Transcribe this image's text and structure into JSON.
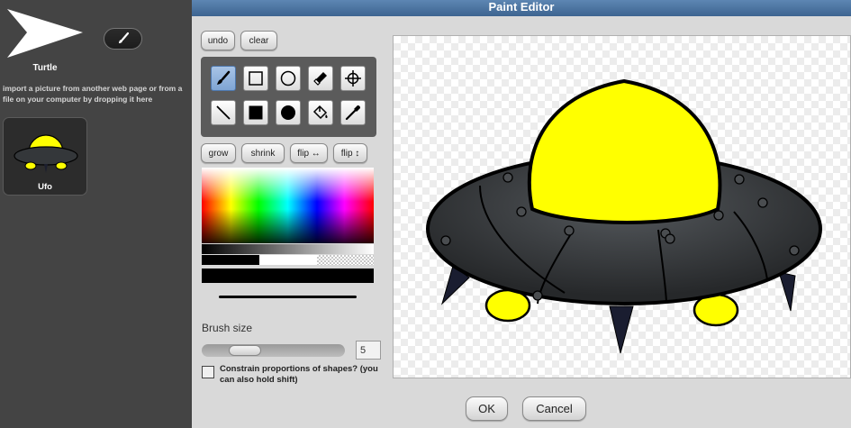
{
  "sprite_corral": {
    "sprite_name": "Turtle",
    "import_hint": "import a picture from another web page or from a file on your computer by dropping it here",
    "costume": {
      "name": "Ufo"
    }
  },
  "dialog": {
    "title": "Paint Editor",
    "undo_label": "undo",
    "clear_label": "clear",
    "grow_label": "grow",
    "shrink_label": "shrink",
    "flip_horizontal_label": "flip ↔",
    "flip_vertical_label": "flip ↕",
    "brush_size_label": "Brush size",
    "brush_size_value": "5",
    "brush_size_fraction": 0.1,
    "constrain_label": "Constrain proportions of shapes? (you can also hold shift)",
    "constrain_checked": false,
    "ok_label": "OK",
    "cancel_label": "Cancel",
    "current_color": "#000000",
    "selected_tool": "brush",
    "tools": [
      "brush",
      "rectangle",
      "ellipse",
      "eraser",
      "rotation-center",
      "line",
      "filled-rectangle",
      "filled-ellipse",
      "paint-bucket",
      "eyedropper"
    ]
  },
  "colors": {
    "title_bar": "#4a73a0",
    "ufo_dome": "#ffff00",
    "ufo_body": "#333538"
  }
}
